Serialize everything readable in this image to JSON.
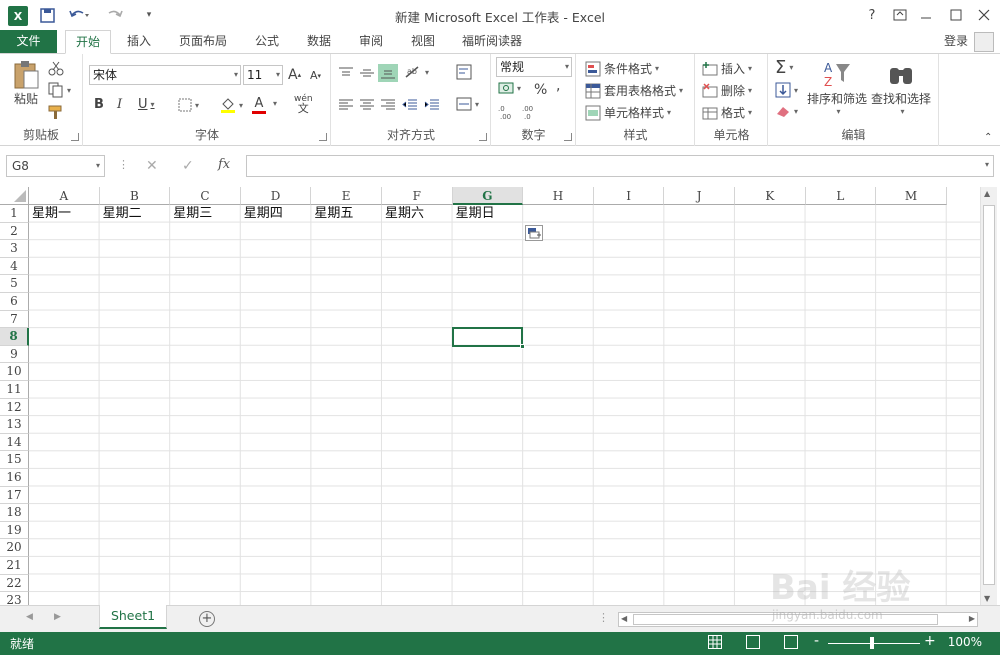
{
  "window": {
    "title": "新建 Microsoft Excel 工作表 - Excel",
    "logo": "X",
    "help": "?"
  },
  "tabs": [
    "文件",
    "开始",
    "插入",
    "页面布局",
    "公式",
    "数据",
    "审阅",
    "视图",
    "福昕阅读器"
  ],
  "account": {
    "login": "登录"
  },
  "ribbon": {
    "clipboard": {
      "label": "剪贴板",
      "paste": "粘贴"
    },
    "font": {
      "label": "字体",
      "name": "宋体",
      "size": "11",
      "bold": "B",
      "italic": "I",
      "underline": "U",
      "grow": "A",
      "shrink": "A",
      "color_a": "A"
    },
    "align": {
      "label": "对齐方式"
    },
    "number": {
      "label": "数字",
      "format": "常规",
      "percent": "%"
    },
    "styles": {
      "label": "样式",
      "cond": "条件格式",
      "table": "套用表格格式",
      "cellstyle": "单元格样式"
    },
    "cells": {
      "label": "单元格",
      "insert": "插入",
      "delete": "删除",
      "format": "格式"
    },
    "editing": {
      "label": "编辑",
      "sort": "排序和筛选",
      "find": "查找和选择",
      "sigma": "Σ"
    }
  },
  "formula_bar": {
    "name_box": "G8",
    "fx": "fx",
    "value": ""
  },
  "grid": {
    "columns": [
      "A",
      "B",
      "C",
      "D",
      "E",
      "F",
      "G",
      "H",
      "I",
      "J",
      "K",
      "L",
      "M"
    ],
    "selected_column": "G",
    "rows": [
      "1",
      "2",
      "3",
      "4",
      "5",
      "6",
      "7",
      "8",
      "9",
      "10",
      "11",
      "12",
      "13",
      "14",
      "15",
      "16",
      "17",
      "18",
      "19",
      "20",
      "21",
      "22",
      "23"
    ],
    "selected_row": "8",
    "row1_values": [
      "星期一",
      "星期二",
      "星期三",
      "星期四",
      "星期五",
      "星期六",
      "星期日"
    ],
    "active_cell": "G8"
  },
  "sheets": {
    "tabs": [
      "Sheet1"
    ],
    "add": "+"
  },
  "status": {
    "text": "就绪",
    "zoom": "100%",
    "zoom_minus": "-",
    "zoom_plus": "+"
  },
  "watermark": {
    "brand": "Bai  经验",
    "url": "jingyan.baidu.com"
  },
  "colors": {
    "accent": "#217346"
  }
}
